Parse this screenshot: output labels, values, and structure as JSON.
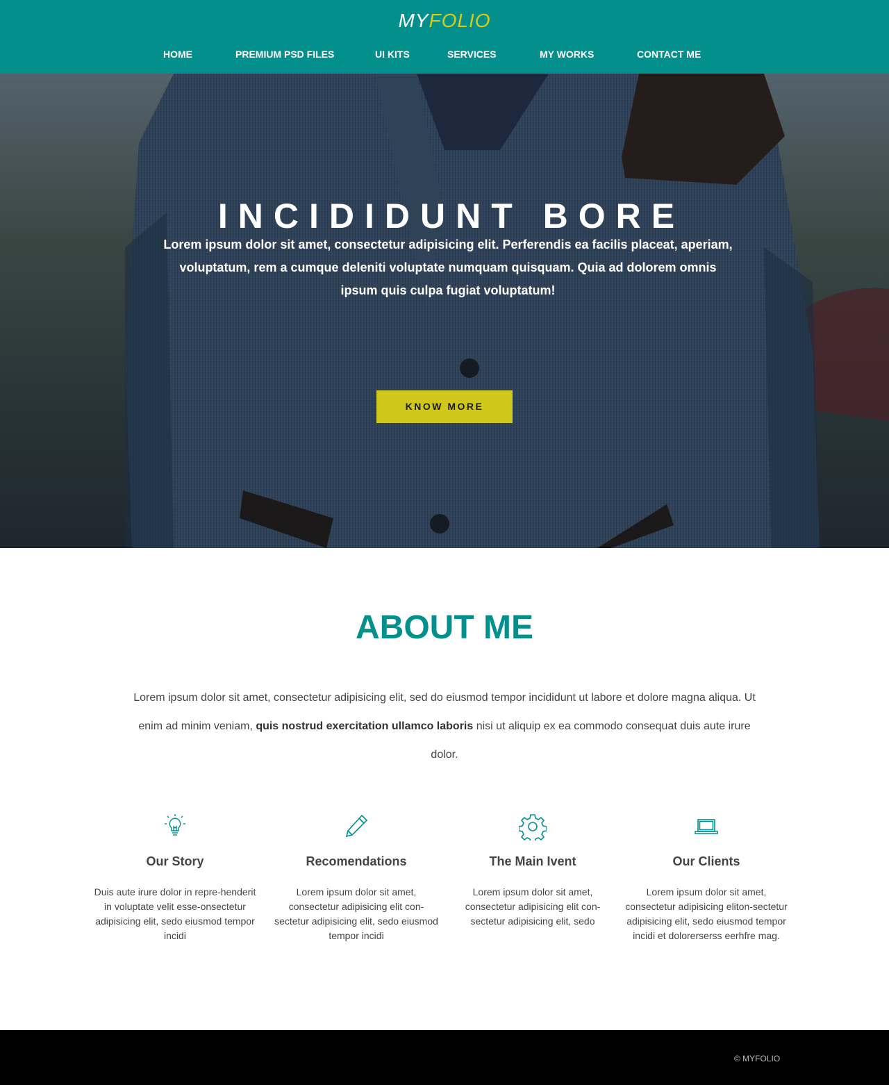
{
  "colors": {
    "primary": "#03908c",
    "accent": "#d4cb1b",
    "footer": "#000000"
  },
  "header": {
    "logo_my": "MY",
    "logo_folio": "FOLIO",
    "nav": [
      "HOME",
      "PREMIUM PSD FILES",
      "UI KITS",
      "SERVICES",
      "MY WORKS",
      "CONTACT ME"
    ]
  },
  "hero": {
    "title": "INCIDIDUNT BORE",
    "text": "Lorem ipsum dolor sit amet, consectetur adipisicing elit. Perferendis ea facilis placeat, aperiam, voluptatum, rem a cumque deleniti voluptate numquam quisquam. Quia ad dolorem omnis ipsum quis culpa fugiat voluptatum!",
    "button": "KNOW MORE"
  },
  "about": {
    "title": "ABOUT ME",
    "text_1": "Lorem ipsum dolor sit amet, consectetur adipisicing elit, sed do eiusmod tempor incididunt ut labore et dolore magna aliqua. Ut enim ad minim veniam,",
    "text_bold": "quis nostrud exercitation ullamco laboris",
    "text_2": "nisi ut aliquip ex ea  commodo consequat duis aute irure dolor."
  },
  "features": [
    {
      "icon": "lightbulb-icon",
      "title": "Our Story",
      "text": "Duis aute irure dolor in repre-henderit in voluptate velit esse-onsectetur adipisicing elit, sedo eiusmod tempor incidi"
    },
    {
      "icon": "pencil-icon",
      "title": "Recomendations",
      "text": "Lorem ipsum dolor sit amet, consectetur adipisicing elit con-sectetur adipisicing elit, sedo eiusmod tempor incidi"
    },
    {
      "icon": "gear-icon",
      "title": "The Main Ivent",
      "text": "Lorem ipsum dolor sit amet, consectetur adipisicing elit con-sectetur adipisicing elit, sedo"
    },
    {
      "icon": "laptop-icon",
      "title": "Our Clients",
      "text": "Lorem ipsum dolor sit amet, consectetur adipisicing eliton-sectetur adipisicing elit, sedo eiusmod tempor incidi et dolorerserss eerhfre mag."
    }
  ],
  "footer": {
    "copyright": "© MYFOLIO"
  }
}
